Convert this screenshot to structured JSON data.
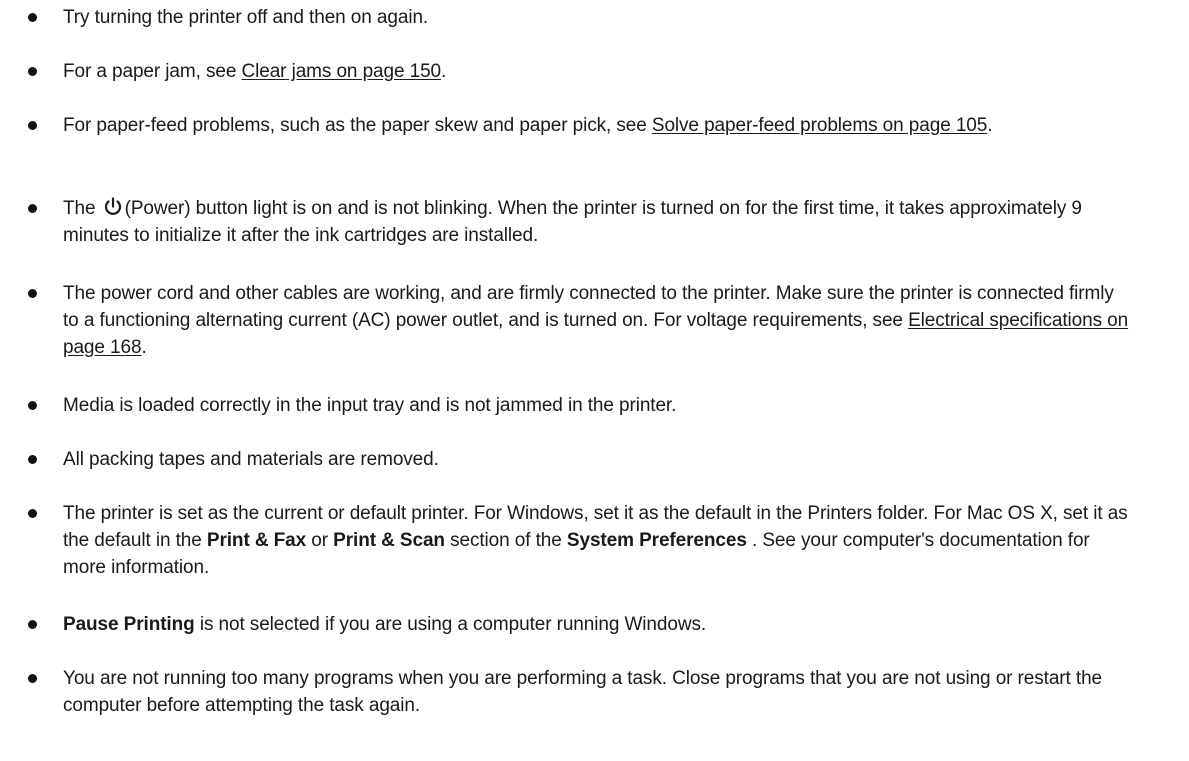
{
  "items": [
    {
      "text": "Try turning the printer off and then on again."
    },
    {
      "before": "For a paper jam, see ",
      "link": "Clear jams on page 150",
      "after": "."
    },
    {
      "before": "For paper-feed problems, such as the paper skew and paper pick, see ",
      "link": "Solve paper-feed problems on page 105",
      "after": "."
    },
    {
      "before": "The ",
      "icon": "power-icon",
      "after": "(Power) button light is on and is not blinking. When the printer is turned on for the first time, it takes approximately 9 minutes to initialize it after the ink cartridges are installed."
    },
    {
      "before": "The power cord and other cables are working, and are firmly connected to the printer. Make sure the printer is connected firmly to a functioning alternating current (AC) power outlet, and is turned on. For voltage requirements, see ",
      "link": "Electrical specifications on page 168",
      "after": "."
    },
    {
      "text": "Media is loaded correctly in the input tray and is not jammed in the printer."
    },
    {
      "text": "All packing tapes and materials are removed."
    },
    {
      "p1": "The printer is set as the current or default printer. For Windows, set it as the default in the Printers folder. For Mac OS X, set it as the default in the ",
      "b1": "Print & Fax",
      "p2": " or ",
      "b2": "Print & Scan",
      "p3": " section of the ",
      "b3": "System Preferences",
      "p4": " . See your computer's documentation for more information."
    },
    {
      "b1": "Pause Printing",
      "p1": " is not selected if you are using a computer running Windows."
    },
    {
      "text": "You are not running too many programs when you are performing a task. Close programs that you are not using or restart the computer before attempting the task again."
    }
  ]
}
